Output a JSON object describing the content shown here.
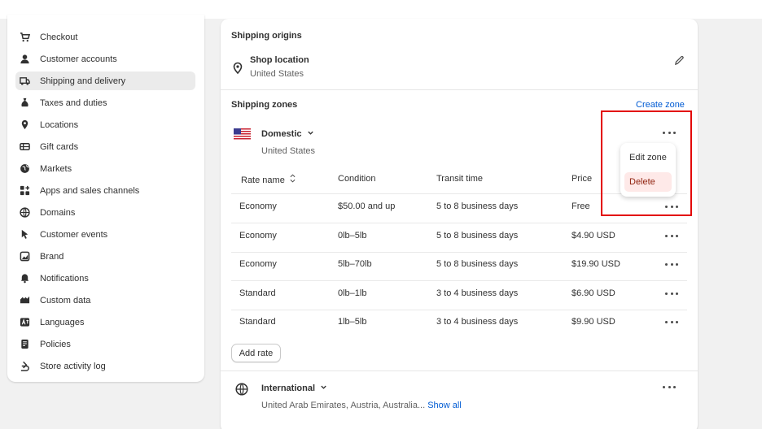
{
  "sidebar": {
    "items": [
      {
        "label": "Checkout",
        "icon": "cart-icon"
      },
      {
        "label": "Customer accounts",
        "icon": "person-icon"
      },
      {
        "label": "Shipping and delivery",
        "icon": "truck-icon",
        "active": true
      },
      {
        "label": "Taxes and duties",
        "icon": "money-bag-icon"
      },
      {
        "label": "Locations",
        "icon": "location-pin-icon"
      },
      {
        "label": "Gift cards",
        "icon": "gift-card-icon"
      },
      {
        "label": "Markets",
        "icon": "globe-icon"
      },
      {
        "label": "Apps and sales channels",
        "icon": "apps-icon"
      },
      {
        "label": "Domains",
        "icon": "domain-globe-icon"
      },
      {
        "label": "Customer events",
        "icon": "cursor-icon"
      },
      {
        "label": "Brand",
        "icon": "brand-icon"
      },
      {
        "label": "Notifications",
        "icon": "bell-icon"
      },
      {
        "label": "Custom data",
        "icon": "custom-data-icon"
      },
      {
        "label": "Languages",
        "icon": "language-icon"
      },
      {
        "label": "Policies",
        "icon": "policy-icon"
      },
      {
        "label": "Store activity log",
        "icon": "activity-log-icon"
      }
    ]
  },
  "origins": {
    "title": "Shipping origins",
    "location_name": "Shop location",
    "location_country": "United States"
  },
  "zones": {
    "title": "Shipping zones",
    "create_label": "Create zone",
    "domestic": {
      "name": "Domestic",
      "country": "United States"
    },
    "table": {
      "headers": [
        "Rate name",
        "Condition",
        "Transit time",
        "Price"
      ],
      "rows": [
        {
          "name": "Economy",
          "condition": "$50.00 and up",
          "transit": "5 to 8 business days",
          "price": "Free"
        },
        {
          "name": "Economy",
          "condition": "0lb–5lb",
          "transit": "5 to 8 business days",
          "price": "$4.90 USD"
        },
        {
          "name": "Economy",
          "condition": "5lb–70lb",
          "transit": "5 to 8 business days",
          "price": "$19.90 USD"
        },
        {
          "name": "Standard",
          "condition": "0lb–1lb",
          "transit": "3 to 4 business days",
          "price": "$6.90 USD"
        },
        {
          "name": "Standard",
          "condition": "1lb–5lb",
          "transit": "3 to 4 business days",
          "price": "$9.90 USD"
        }
      ]
    },
    "add_rate_label": "Add rate",
    "international": {
      "name": "International",
      "countries": "United Arab Emirates, Austria, Australia...",
      "show_all_label": "Show all"
    }
  },
  "popover": {
    "edit_label": "Edit zone",
    "delete_label": "Delete"
  },
  "colors": {
    "link": "#005bd3",
    "highlight": "#e30000",
    "danger_bg": "#fee9e8"
  }
}
